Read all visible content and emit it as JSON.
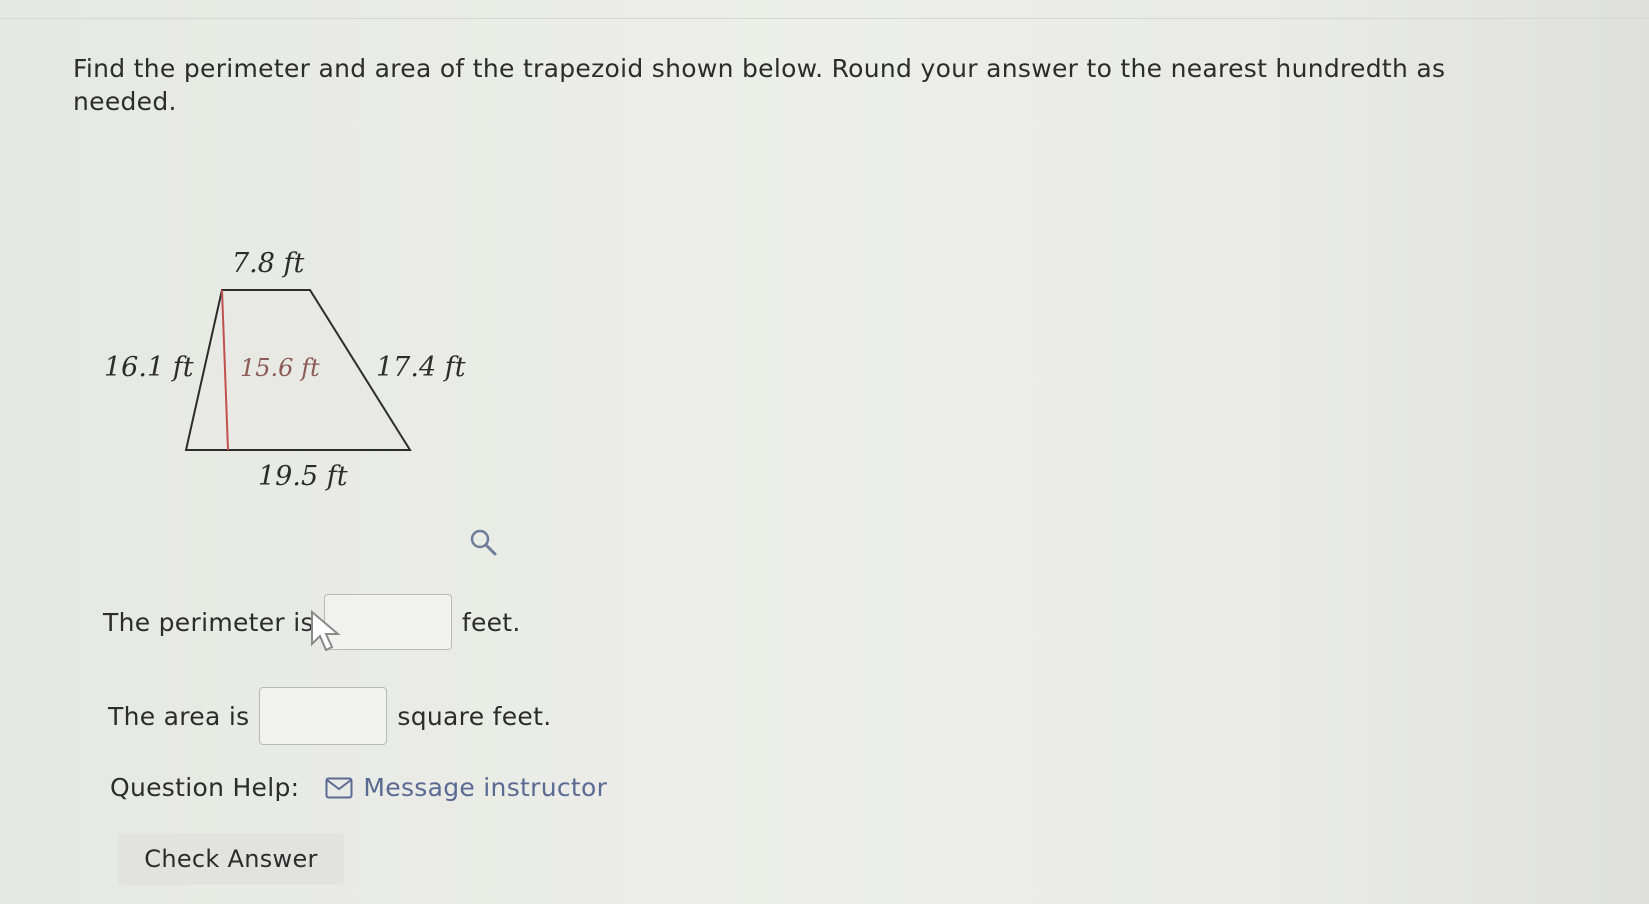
{
  "question": {
    "prompt": "Find the perimeter and area of the trapezoid shown below. Round your answer to the nearest hundredth as needed."
  },
  "figure": {
    "shape": "trapezoid",
    "top_base": "7.8 ft",
    "bottom_base": "19.5 ft",
    "left_side": "16.1 ft",
    "right_side": "17.4 ft",
    "height": "15.6 ft",
    "height_color": "#c0504d",
    "outline_color": "#2c2c2c",
    "fill_color": "#e8e9e5"
  },
  "perimeter": {
    "prefix": "The perimeter is",
    "value": "",
    "suffix": "feet."
  },
  "area": {
    "prefix": "The area is",
    "value": "",
    "suffix": "square feet."
  },
  "help": {
    "label": "Question Help:",
    "link_label": "Message instructor",
    "link_icon": "envelope-icon",
    "link_color": "#5a6a92"
  },
  "check_button": {
    "label": "Check Answer"
  },
  "icons": {
    "zoom": "magnifier-icon",
    "cursor": "mouse-pointer-icon"
  }
}
